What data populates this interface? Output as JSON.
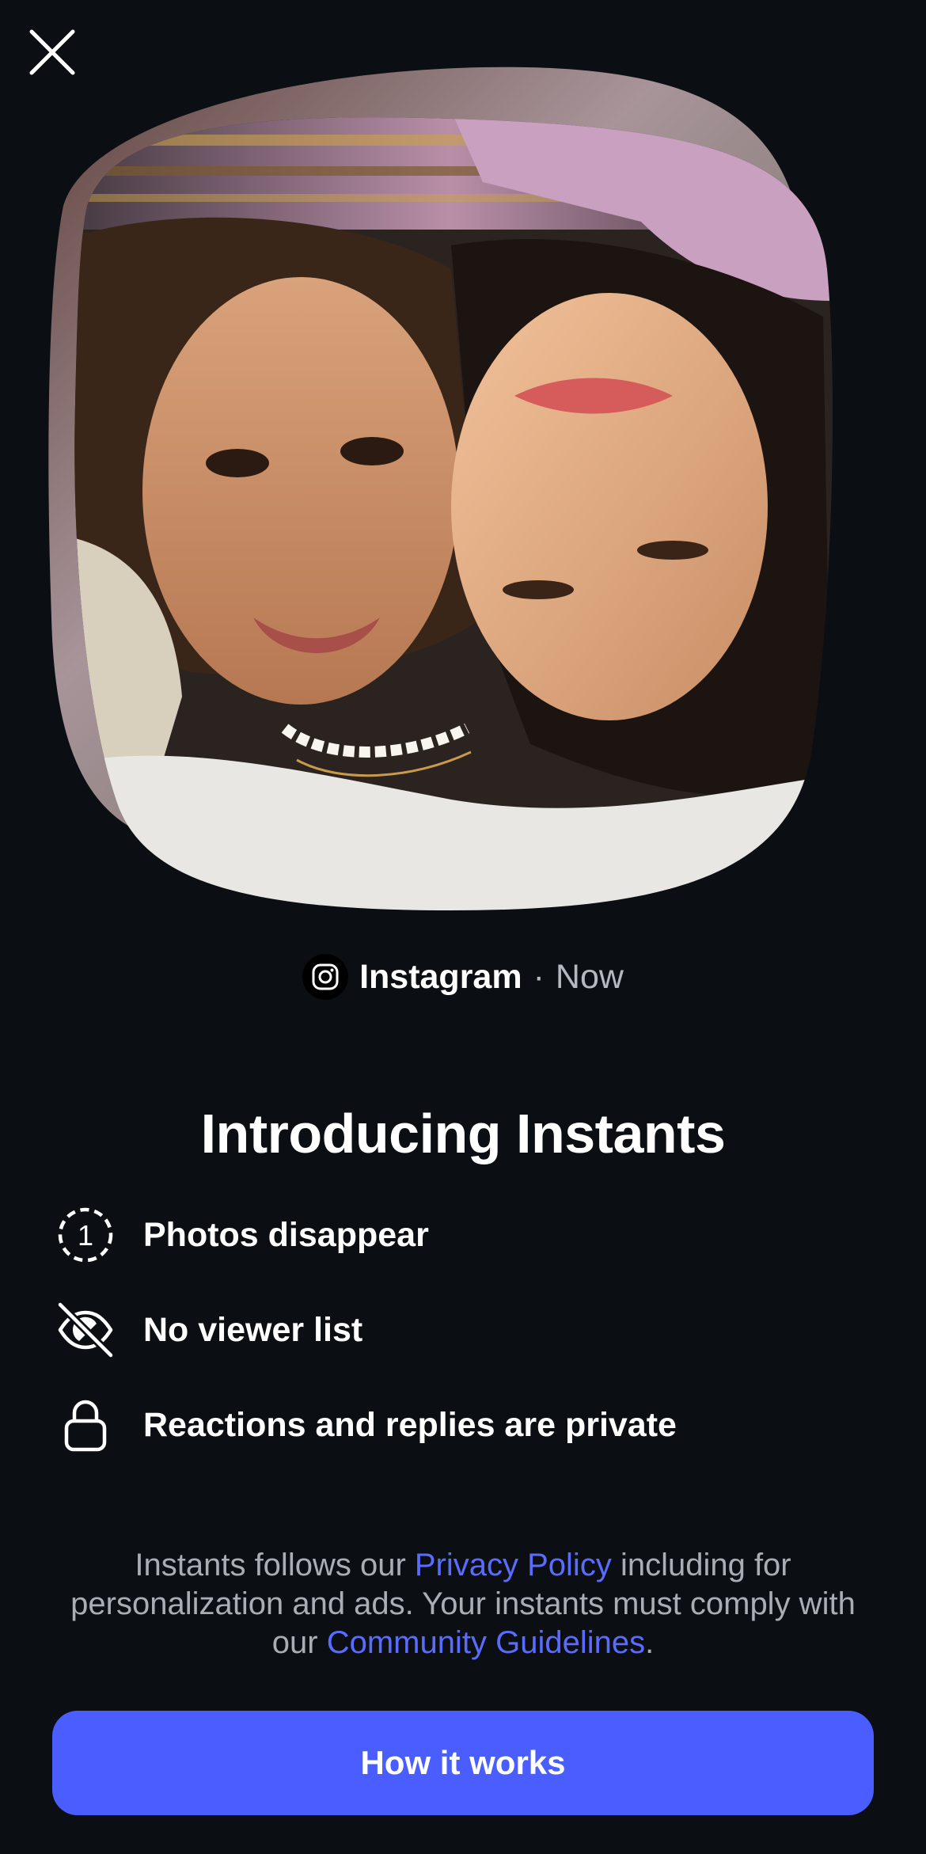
{
  "header": {
    "close_icon": "close-icon"
  },
  "photo": {
    "description_icon": "selfie-photo",
    "shape": "squircle-card-stack"
  },
  "meta": {
    "app_name": "Instagram",
    "separator": "·",
    "time": "Now",
    "app_icon": "instagram-icon"
  },
  "title": "Introducing Instants",
  "features": [
    {
      "icon": "timer-one-icon",
      "label": "Photos disappear"
    },
    {
      "icon": "eye-off-icon",
      "label": "No viewer list"
    },
    {
      "icon": "lock-icon",
      "label": "Reactions and replies are private"
    }
  ],
  "legal": {
    "part1": "Instants follows our ",
    "privacy_link": "Privacy Policy",
    "part2": " including for personalization and ads. Your instants must comply with our ",
    "guidelines_link": "Community Guidelines",
    "part3": "."
  },
  "cta": {
    "label": "How it works"
  },
  "colors": {
    "background": "#0b0f14",
    "accent": "#4a5dff",
    "link": "#5a6cff",
    "muted_text": "#a9adb4"
  }
}
